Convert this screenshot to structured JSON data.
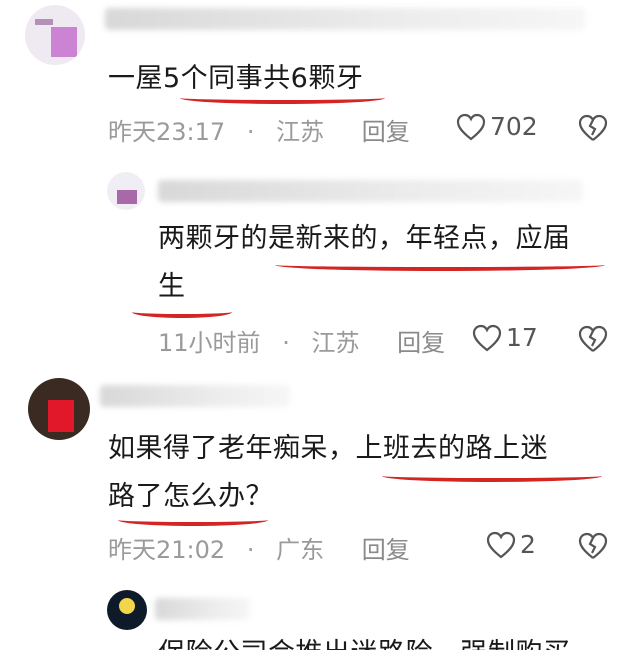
{
  "comments": [
    {
      "text": "一屋5个同事共6颗牙",
      "time": "昨天23:17",
      "region": "江苏",
      "reply_label": "回复",
      "likes": "702"
    },
    {
      "text_line1": "两颗牙的是新来的，年轻点，应届",
      "text_line2": "生",
      "time": "11小时前",
      "region": "江苏",
      "reply_label": "回复",
      "likes": "17"
    },
    {
      "text_line1": "如果得了老年痴呆，上班去的路上迷",
      "text_line2": "路了怎么办？",
      "time": "昨天21:02",
      "region": "广东",
      "reply_label": "回复",
      "likes": "2"
    },
    {
      "partial_text": "保险公司会推出迷路险，强制购买"
    }
  ],
  "separator": "·",
  "colors": {
    "underline": "#d42525",
    "meta": "#9a9a9a"
  }
}
